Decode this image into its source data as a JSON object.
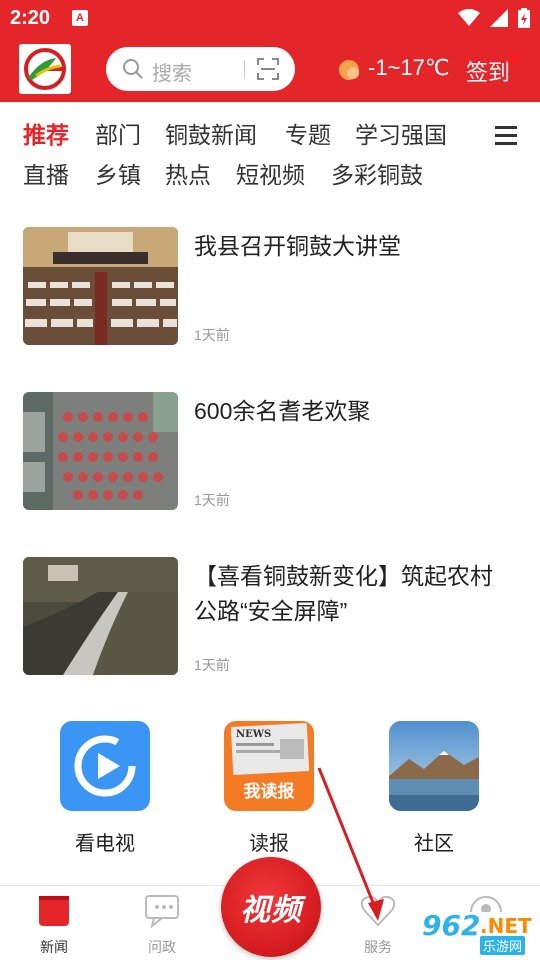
{
  "status_bar": {
    "time": "2:20",
    "badge": "A"
  },
  "header": {
    "search_placeholder": "搜索",
    "weather": "-1~17℃",
    "signin_label": "签到",
    "accent_color": "#e4262a"
  },
  "tabs": {
    "row1": [
      "推荐",
      "部门",
      "铜鼓新闻",
      "专题",
      "学习强国"
    ],
    "row2": [
      "直播",
      "乡镇",
      "热点",
      "短视频",
      "多彩铜鼓"
    ],
    "active": "推荐"
  },
  "news": [
    {
      "title": "我县召开铜鼓大讲堂",
      "time": "1天前"
    },
    {
      "title": "600余名耆老欢聚",
      "time": "1天前"
    },
    {
      "title": "【喜看铜鼓新变化】筑起农村公路“安全屏障”",
      "time": "1天前"
    }
  ],
  "services": [
    {
      "label": "看电视",
      "icon": "tv-play-icon"
    },
    {
      "label": "读报",
      "icon": "newspaper-icon",
      "icon_text": "我读报",
      "icon_news": "NEWS"
    },
    {
      "label": "社区",
      "icon": "landscape-icon"
    }
  ],
  "bottom_nav": {
    "items": [
      {
        "label": "新闻",
        "icon": "news-icon",
        "active": true
      },
      {
        "label": "问政",
        "icon": "chat-icon",
        "active": false
      },
      {
        "label": "服务",
        "icon": "heart-icon",
        "active": false
      }
    ],
    "center_label": "视频"
  },
  "watermark": {
    "num": "962",
    "net": ".NET",
    "sub": "乐游网"
  }
}
